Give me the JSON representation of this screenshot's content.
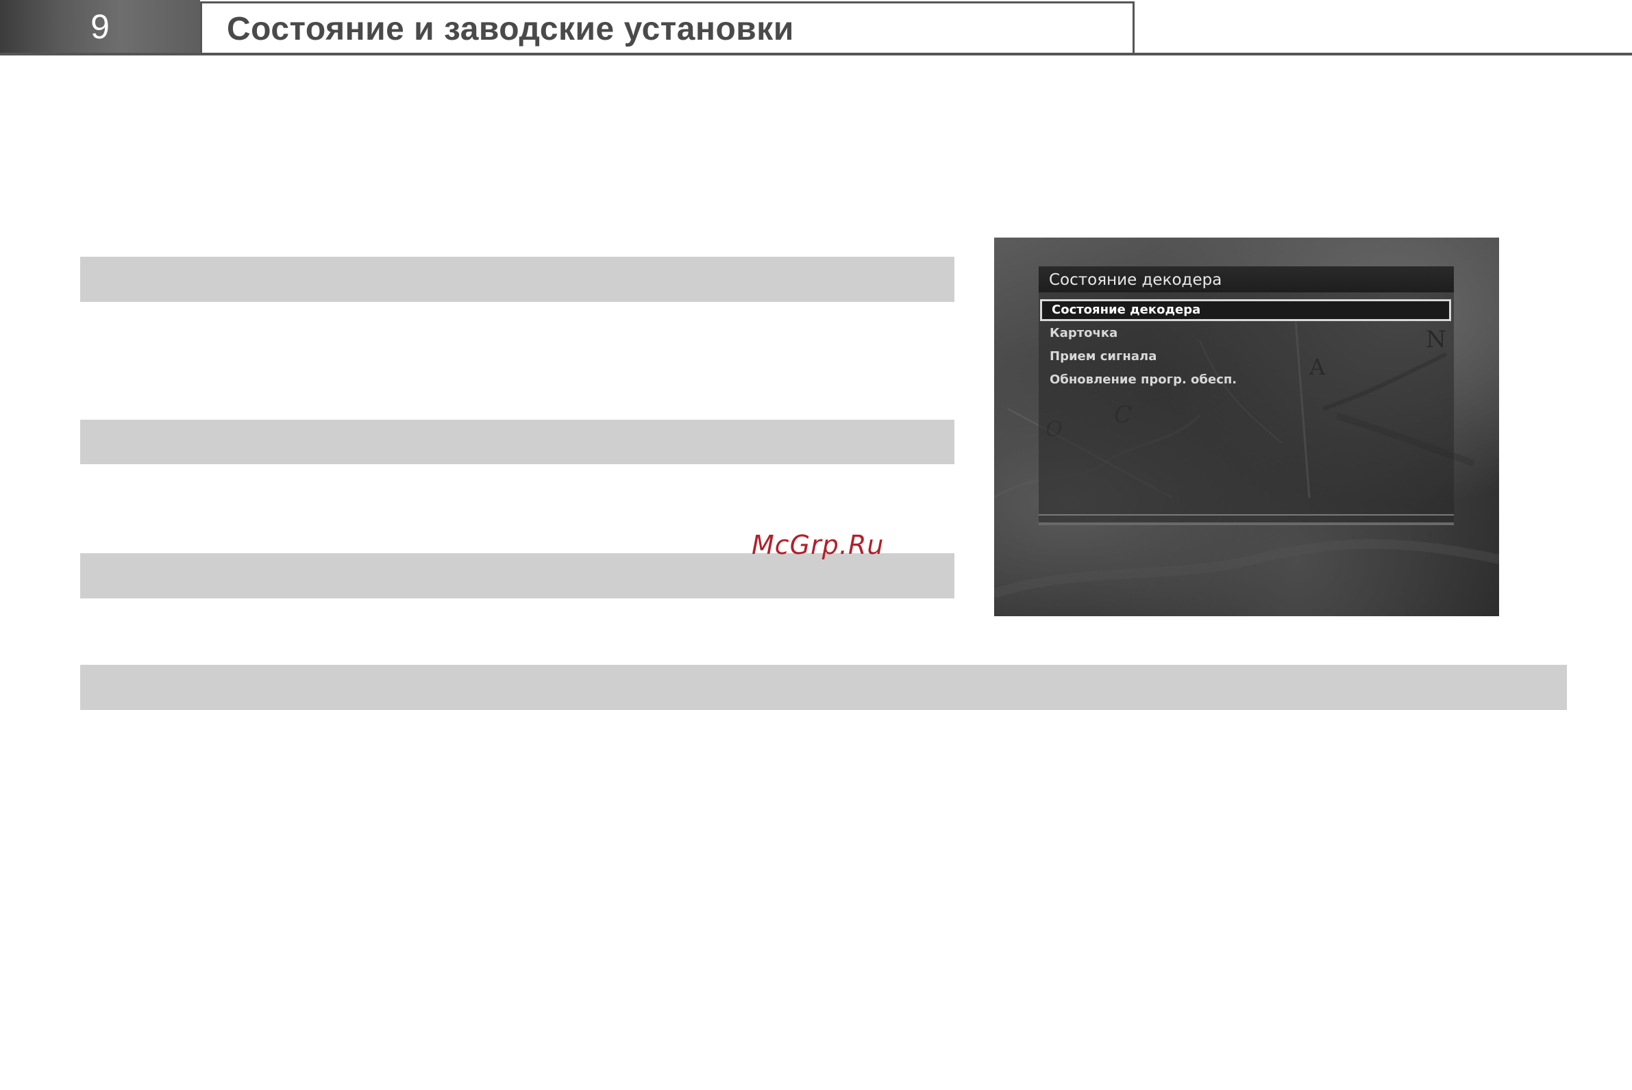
{
  "header": {
    "section_number": "9",
    "title": "Состояние и заводские установки"
  },
  "watermark": "McGrp.Ru",
  "tv_menu": {
    "title": "Состояние декодера",
    "items": [
      {
        "label": "Состояние декодера",
        "selected": true
      },
      {
        "label": "Карточка",
        "selected": false
      },
      {
        "label": "Прием сигнала",
        "selected": false
      },
      {
        "label": "Обновление прогр. обесп.",
        "selected": false
      }
    ]
  }
}
